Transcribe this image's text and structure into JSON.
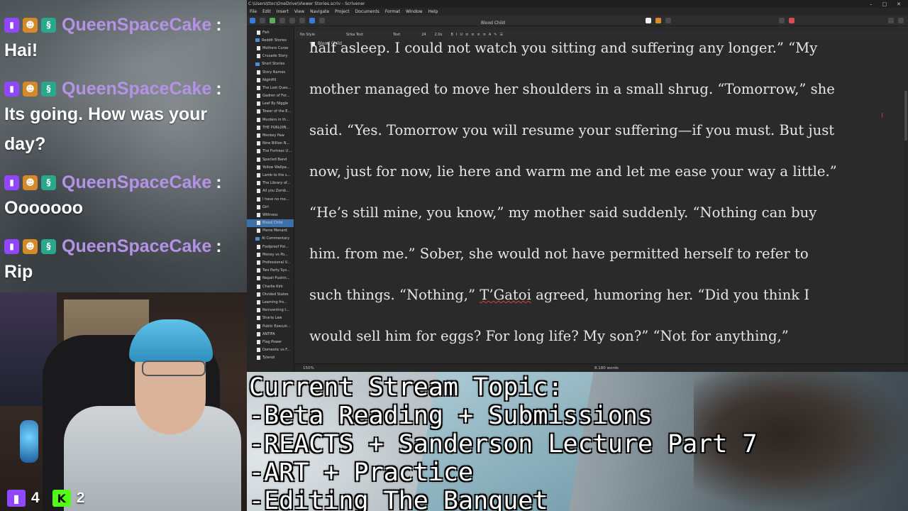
{
  "chat": {
    "messages": [
      {
        "user": "QueenSpaceCake",
        "text": "Hai!"
      },
      {
        "user": "QueenSpaceCake",
        "text": "Its going. How was your day?"
      },
      {
        "user": "QueenSpaceCake",
        "text": "Ooooooo"
      },
      {
        "user": "QueenSpaceCake",
        "text": "Rip"
      }
    ]
  },
  "webcam": {
    "stats": [
      {
        "icon": "twitch-icon",
        "value": "4"
      },
      {
        "icon": "kick-icon",
        "value": "2"
      }
    ]
  },
  "app": {
    "title": "C:\\Users\\ttoc\\OneDrive\\Viewer Stories.scriv - Scrivener",
    "menu": [
      "File",
      "Edit",
      "Insert",
      "View",
      "Navigate",
      "Project",
      "Documents",
      "Format",
      "Window",
      "Help"
    ],
    "document_title": "Blood Child",
    "path_label": "Blood Child",
    "binder": [
      {
        "label": "Fish",
        "type": "doc"
      },
      {
        "label": "Reddit Stories",
        "type": "folder"
      },
      {
        "label": "Mothers Curse",
        "type": "doc"
      },
      {
        "label": "Crusade Story",
        "type": "doc"
      },
      {
        "label": "Short Stories",
        "type": "folder"
      },
      {
        "label": "Story Names",
        "type": "doc"
      },
      {
        "label": "Nightfill",
        "type": "doc"
      },
      {
        "label": "The Lost Ques...",
        "type": "doc"
      },
      {
        "label": "Gadren of For...",
        "type": "doc"
      },
      {
        "label": "Leaf By Niggle",
        "type": "doc"
      },
      {
        "label": "Tower of the E...",
        "type": "doc"
      },
      {
        "label": "Murders in th...",
        "type": "doc"
      },
      {
        "label": "THE PURLOIN...",
        "type": "doc"
      },
      {
        "label": "Monkey Paw",
        "type": "doc"
      },
      {
        "label": "Nine Billion N...",
        "type": "doc"
      },
      {
        "label": "The Fortress U...",
        "type": "doc"
      },
      {
        "label": "Specled Band",
        "type": "doc"
      },
      {
        "label": "Yellow Wallpa...",
        "type": "doc"
      },
      {
        "label": "Lamb to the s...",
        "type": "doc"
      },
      {
        "label": "The Library of...",
        "type": "doc"
      },
      {
        "label": "All you Zomb...",
        "type": "doc"
      },
      {
        "label": "I have no mo...",
        "type": "doc"
      },
      {
        "label": "Girl",
        "type": "doc"
      },
      {
        "label": "Wittness",
        "type": "doc"
      },
      {
        "label": "Blood Child",
        "type": "doc",
        "selected": true
      },
      {
        "label": "Pierre Menard",
        "type": "doc"
      },
      {
        "label": "AI Commentary",
        "type": "folder"
      },
      {
        "label": "Foolproof Pol...",
        "type": "doc"
      },
      {
        "label": "Money vs Po...",
        "type": "doc"
      },
      {
        "label": "Professional V...",
        "type": "doc"
      },
      {
        "label": "Two Party Sys...",
        "type": "doc"
      },
      {
        "label": "Nepali Pushin...",
        "type": "doc"
      },
      {
        "label": "Charlie Kirk",
        "type": "doc"
      },
      {
        "label": "Divided States",
        "type": "doc"
      },
      {
        "label": "Learning fro...",
        "type": "doc"
      },
      {
        "label": "Reinventing t...",
        "type": "doc"
      },
      {
        "label": "Sharia Law",
        "type": "doc"
      },
      {
        "label": "Public Executi...",
        "type": "doc"
      },
      {
        "label": "ANTIFA",
        "type": "doc"
      },
      {
        "label": "Flag Power",
        "type": "doc"
      },
      {
        "label": "Domestic vs F...",
        "type": "doc"
      },
      {
        "label": "Tylenol",
        "type": "doc"
      }
    ],
    "format": {
      "style": "No Style",
      "font": "Sitka Text",
      "variant": "Text",
      "size": "24",
      "spacing": "2.0x"
    },
    "editor_lines": [
      "half asleep. I could not watch you sitting and suffering any longer.” “My",
      "mother managed to move her shoulders in a small shrug. “Tomorrow,” she",
      "said. “Yes. Tomorrow you will resume your suffering—if you must. But just",
      "now, just for now, lie here and warm me and let me ease your way a little.”",
      "“He’s still mine, you know,” my mother said suddenly. “Nothing can buy",
      "him. from me.” Sober, she would not have permitted herself to refer to",
      "would sell him for eggs? For long life? My son?” “Not for anything,”"
    ],
    "editor_line_7_parts": {
      "before": "such things. “Nothing,” ",
      "misspelled": "T’Gatoi",
      "after": " agreed, humoring her. “Did you think I"
    },
    "zoom": "150%",
    "word_count": "8,180 words"
  },
  "banner": {
    "lines": [
      "Current Stream Topic:",
      "-Beta Reading + Submissions",
      "-REACTS + Sanderson Lecture Part 7",
      "-ART + Practice",
      "-Editing The Banquet"
    ]
  },
  "colors": {
    "username": "#b493e6",
    "twitch": "#9146ff",
    "kick": "#53fc18",
    "selection": "#3d6fa8"
  }
}
